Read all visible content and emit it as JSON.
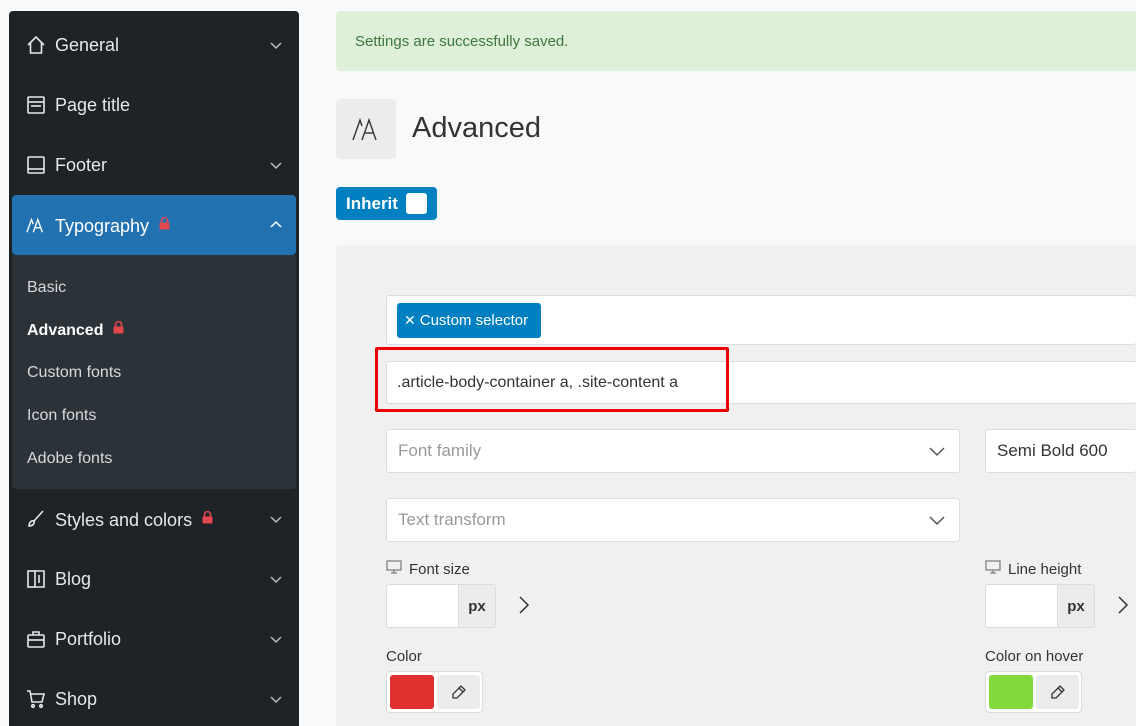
{
  "sidebar": {
    "items": [
      {
        "label": "General",
        "icon": "home-icon"
      },
      {
        "label": "Page title",
        "icon": "page-title-icon"
      },
      {
        "label": "Footer",
        "icon": "footer-icon"
      },
      {
        "label": "Typography",
        "icon": "typography-icon"
      },
      {
        "label": "Styles and colors",
        "icon": "brush-icon"
      },
      {
        "label": "Blog",
        "icon": "blog-icon"
      },
      {
        "label": "Portfolio",
        "icon": "briefcase-icon"
      },
      {
        "label": "Shop",
        "icon": "cart-icon"
      }
    ],
    "submenu": [
      "Basic",
      "Advanced",
      "Custom fonts",
      "Icon fonts",
      "Adobe fonts"
    ]
  },
  "notice": "Settings are successfully saved.",
  "page": {
    "title": "Advanced"
  },
  "inherit_label": "Inherit",
  "form": {
    "tag": "Custom selector",
    "selector_value": ".article-body-container a, .site-content a",
    "font_family_placeholder": "Font family",
    "font_weight": "Semi Bold 600",
    "text_transform_placeholder": "Text transform",
    "font_size_label": "Font size",
    "line_height_label": "Line height",
    "unit": "px",
    "color_label": "Color",
    "color_hover_label": "Color on hover"
  },
  "colors": {
    "accent": "#2271b1",
    "tag": "#0080c1",
    "color": "#e03131",
    "color_hover": "#84d93c",
    "lock": "#e0484e"
  }
}
